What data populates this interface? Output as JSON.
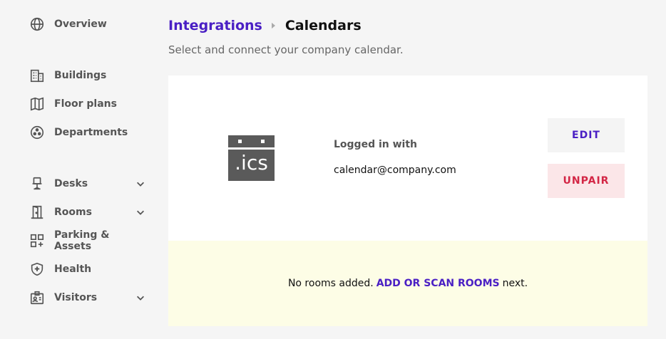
{
  "sidebar": {
    "items": [
      {
        "label": "Overview",
        "icon": "globe-icon"
      },
      {
        "label": "Buildings",
        "icon": "building-icon"
      },
      {
        "label": "Floor plans",
        "icon": "map-icon"
      },
      {
        "label": "Departments",
        "icon": "departments-icon"
      },
      {
        "label": "Desks",
        "icon": "desk-chair-icon",
        "expandable": true
      },
      {
        "label": "Rooms",
        "icon": "door-icon",
        "expandable": true
      },
      {
        "label": "Parking & Assets",
        "icon": "grid-plus-icon"
      },
      {
        "label": "Health",
        "icon": "shield-plus-icon"
      },
      {
        "label": "Visitors",
        "icon": "badge-icon",
        "expandable": true
      }
    ]
  },
  "header": {
    "breadcrumb_parent": "Integrations",
    "breadcrumb_current": "Calendars",
    "subtitle": "Select and connect your company calendar."
  },
  "calendar_card": {
    "logo_text": ".ics",
    "logged_in_label": "Logged in with",
    "email": "calendar@company.com",
    "edit_label": "EDIT",
    "unpair_label": "UNPAIR"
  },
  "notice": {
    "prefix": "No rooms added.",
    "link": "ADD OR SCAN ROOMS",
    "suffix": "next."
  },
  "colors": {
    "accent": "#4a1fc4",
    "danger": "#d32645",
    "danger_bg": "#fbe6e8",
    "notice_bg": "#fdfde6"
  }
}
